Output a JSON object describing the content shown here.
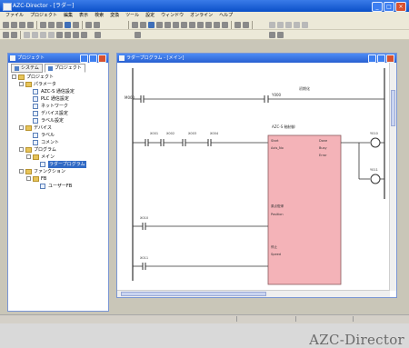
{
  "window": {
    "title": "AZC-Director - [ラダー]"
  },
  "menu": {
    "items": [
      "ファイル",
      "プロジェクト",
      "編集",
      "表示",
      "検索",
      "変換",
      "ツール",
      "設定",
      "ウィンドウ",
      "オンライン",
      "ヘルプ"
    ]
  },
  "project_panel": {
    "title": "プロジェクト",
    "tabs": [
      "システム",
      "プロジェクト"
    ],
    "tree": [
      {
        "label": "プロジェクト",
        "depth": 0,
        "kind": "folder"
      },
      {
        "label": "パラメータ",
        "depth": 1,
        "kind": "folder"
      },
      {
        "label": "AZC-S 通信設定",
        "depth": 2,
        "kind": "doc"
      },
      {
        "label": "PLC 通信設定",
        "depth": 2,
        "kind": "doc"
      },
      {
        "label": "ネットワーク",
        "depth": 2,
        "kind": "doc"
      },
      {
        "label": "デバイス設定",
        "depth": 2,
        "kind": "doc"
      },
      {
        "label": "ラベル設定",
        "depth": 2,
        "kind": "doc"
      },
      {
        "label": "デバイス",
        "depth": 1,
        "kind": "folder"
      },
      {
        "label": "ラベル",
        "depth": 2,
        "kind": "doc"
      },
      {
        "label": "コメント",
        "depth": 2,
        "kind": "doc"
      },
      {
        "label": "プログラム",
        "depth": 1,
        "kind": "folder"
      },
      {
        "label": "メイン",
        "depth": 2,
        "kind": "folder"
      },
      {
        "label": "ラダープログラム",
        "depth": 3,
        "kind": "doc",
        "selected": true
      },
      {
        "label": "ファンクション",
        "depth": 1,
        "kind": "folder"
      },
      {
        "label": "FB",
        "depth": 2,
        "kind": "folder"
      },
      {
        "label": "ユーザーFB",
        "depth": 3,
        "kind": "doc"
      }
    ]
  },
  "ladder_panel": {
    "title": "ラダープログラム - [メイン]",
    "rung_labels": {
      "r1_contact": "M000",
      "r1_coil": "Y000",
      "r1_comment": "初期化",
      "r2_contacts": [
        "X001",
        "X002",
        "X003",
        "X004"
      ],
      "fb_header": "AZC-S 軸制御",
      "fb_in1": "Start",
      "fb_in2": "Axis_No",
      "fb_in3": "Position",
      "fb_in4": "Speed",
      "fb_out1": "Done",
      "fb_out2": "Busy",
      "fb_out3": "Error",
      "right_coil_top": "Y010",
      "right_coil_bottom": "Y011",
      "r3_contact": "X010",
      "r3_label": "原点復帰",
      "r4_contact": "X011",
      "r4_label": "停止"
    }
  },
  "watermark": "AZC-Director",
  "colors": {
    "titlebar": "#0b50c8",
    "fb_block": "#f4b3b8",
    "ladder_line": "#333333"
  }
}
